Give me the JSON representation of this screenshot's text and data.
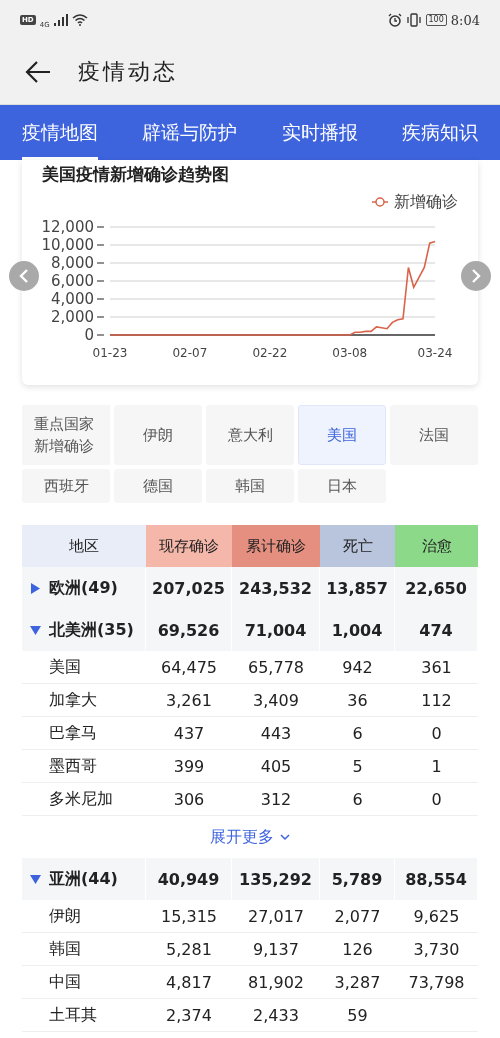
{
  "status_bar": {
    "hd": "HD",
    "network": "4G",
    "battery": "100",
    "time": "8:04"
  },
  "app_bar": {
    "title": "疫情动态"
  },
  "tabs": [
    {
      "label": "疫情地图",
      "selected": true
    },
    {
      "label": "辟谣与防护",
      "selected": false
    },
    {
      "label": "实时播报",
      "selected": false
    },
    {
      "label": "疾病知识",
      "selected": false
    }
  ],
  "trend_card": {
    "title": "美国疫情新增确诊趋势图",
    "chart_data": {
      "type": "line",
      "categories": [
        "01-23",
        null,
        null,
        null,
        null,
        null,
        null,
        null,
        null,
        null,
        null,
        null,
        null,
        null,
        null,
        "02-07",
        null,
        null,
        null,
        null,
        null,
        null,
        null,
        null,
        null,
        null,
        null,
        null,
        null,
        null,
        "02-22",
        null,
        null,
        null,
        null,
        null,
        null,
        null,
        null,
        null,
        null,
        null,
        null,
        null,
        null,
        "03-08",
        null,
        null,
        null,
        null,
        null,
        null,
        null,
        null,
        null,
        null,
        null,
        null,
        null,
        null,
        null,
        "03-24"
      ],
      "ylim": [
        0,
        12000
      ],
      "grid": true,
      "yticks": [
        0,
        {
          "value": 2000,
          "label": "2,000"
        },
        {
          "value": 4000,
          "label": "4,000"
        },
        {
          "value": 6000,
          "label": "6,000"
        },
        {
          "value": 8000,
          "label": "8,000"
        },
        {
          "value": 10000,
          "label": "10,000"
        },
        {
          "value": 12000,
          "label": "12,000"
        }
      ],
      "series": [
        {
          "name": "新增确诊",
          "color": "#d9634b",
          "values": [
            0,
            0,
            0,
            0,
            0,
            0,
            0,
            0,
            0,
            0,
            0,
            0,
            0,
            0,
            0,
            0,
            0,
            0,
            0,
            0,
            0,
            0,
            0,
            0,
            0,
            0,
            0,
            0,
            0,
            0,
            0,
            0,
            0,
            0,
            0,
            0,
            0,
            0,
            0,
            0,
            0,
            0,
            0,
            0,
            0,
            0,
            300,
            300,
            400,
            400,
            900,
            800,
            700,
            1400,
            1700,
            1800,
            7500,
            5300,
            6400,
            7500,
            10200,
            10400
          ]
        }
      ]
    }
  },
  "country_selector": {
    "label": "重点国家新增确诊",
    "countries": [
      {
        "label": "伊朗",
        "selected": false
      },
      {
        "label": "意大利",
        "selected": false
      },
      {
        "label": "美国",
        "selected": true
      },
      {
        "label": "法国",
        "selected": false
      },
      {
        "label": "西班牙",
        "selected": false
      },
      {
        "label": "德国",
        "selected": false
      },
      {
        "label": "韩国",
        "selected": false
      },
      {
        "label": "日本",
        "selected": false
      }
    ]
  },
  "table": {
    "columns": [
      {
        "label": "地区",
        "color": "#e9edf7"
      },
      {
        "label": "现存确诊",
        "color": "#f4b7aa"
      },
      {
        "label": "累计确诊",
        "color": "#e58f80"
      },
      {
        "label": "死亡",
        "color": "#b9c5dc"
      },
      {
        "label": "治愈",
        "color": "#8cd98a"
      }
    ],
    "groups": [
      {
        "region": "欧洲(49)",
        "expanded": false,
        "values": [
          "207,025",
          "243,532",
          "13,857",
          "22,650"
        ]
      },
      {
        "region": "北美洲(35)",
        "expanded": true,
        "values": [
          "69,526",
          "71,004",
          "1,004",
          "474"
        ],
        "children": [
          {
            "region": "美国",
            "values": [
              "64,475",
              "65,778",
              "942",
              "361"
            ]
          },
          {
            "region": "加拿大",
            "values": [
              "3,261",
              "3,409",
              "36",
              "112"
            ]
          },
          {
            "region": "巴拿马",
            "values": [
              "437",
              "443",
              "6",
              "0"
            ]
          },
          {
            "region": "墨西哥",
            "values": [
              "399",
              "405",
              "5",
              "1"
            ]
          },
          {
            "region": "多米尼加",
            "values": [
              "306",
              "312",
              "6",
              "0"
            ]
          }
        ],
        "more_link": "展开更多"
      },
      {
        "region": "亚洲(44)",
        "expanded": true,
        "values": [
          "40,949",
          "135,292",
          "5,789",
          "88,554"
        ],
        "children": [
          {
            "region": "伊朗",
            "values": [
              "15,315",
              "27,017",
              "2,077",
              "9,625"
            ]
          },
          {
            "region": "韩国",
            "values": [
              "5,281",
              "9,137",
              "126",
              "3,730"
            ]
          },
          {
            "region": "中国",
            "values": [
              "4,817",
              "81,902",
              "3,287",
              "73,798"
            ]
          },
          {
            "region": "土耳其",
            "values": [
              "2,374",
              "2,433",
              "59"
            ]
          }
        ]
      }
    ]
  }
}
